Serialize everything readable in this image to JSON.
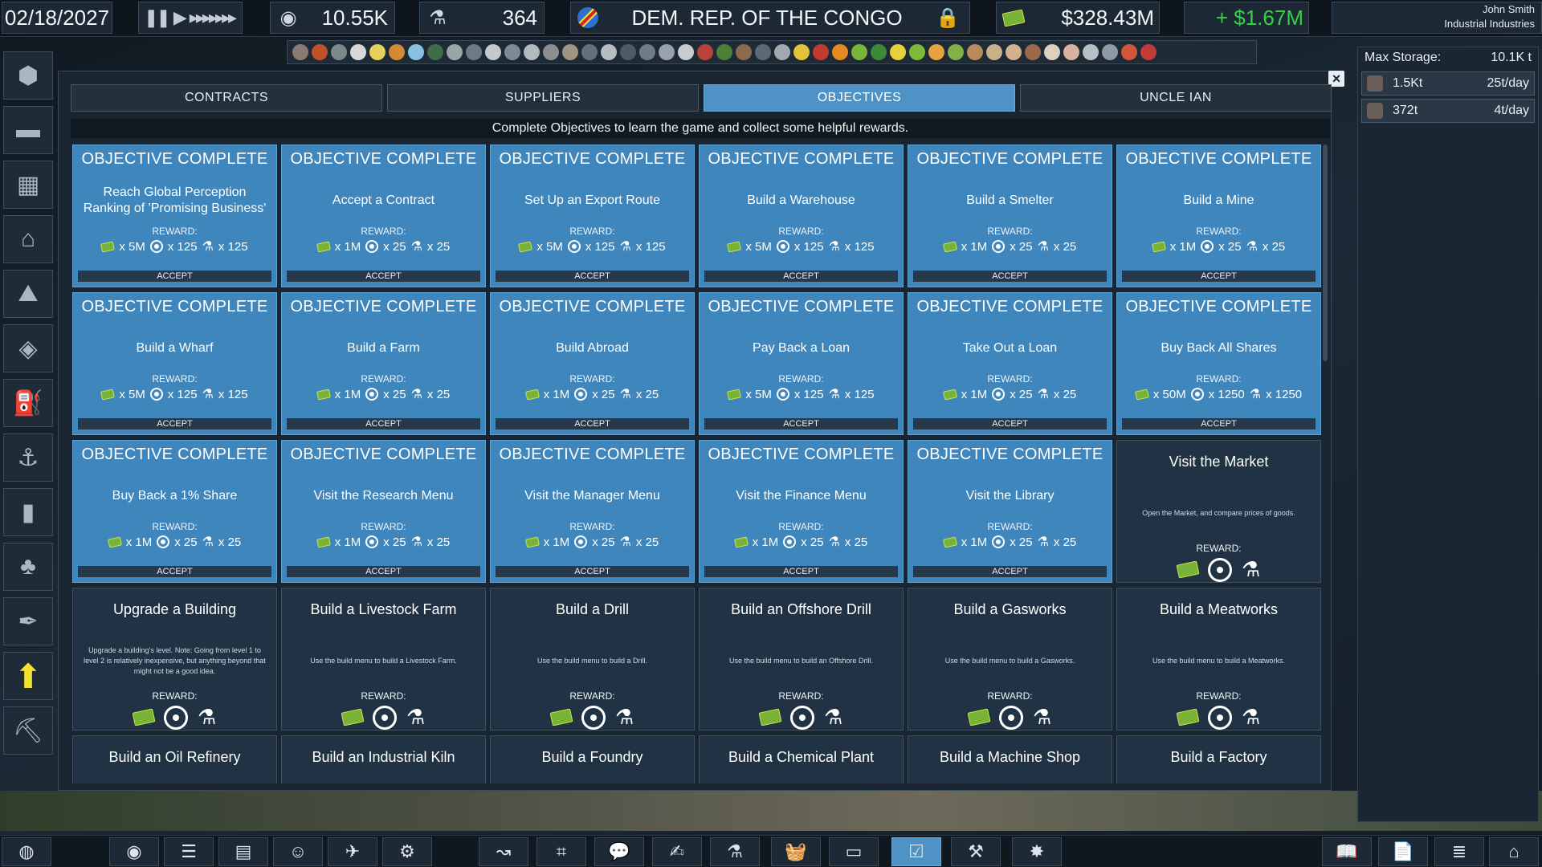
{
  "topbar": {
    "date": "02/18/2027",
    "speed_icons": [
      "pause-icon",
      "play-icon",
      "fast-forward-icon"
    ],
    "perception": "10.55K",
    "research": "364",
    "region": "DEM. REP. OF THE CONGO",
    "cash": "$328.43M",
    "cash_delta": "+ $1.67M",
    "user_name": "John Smith",
    "company": "Industrial Industries"
  },
  "colors": {
    "accent": "#4f92c6",
    "complete_card": "#3f86bd",
    "todo_card": "#203244",
    "cash_delta": "#38d046"
  },
  "tabs": [
    {
      "label": "CONTRACTS",
      "active": false
    },
    {
      "label": "SUPPLIERS",
      "active": false
    },
    {
      "label": "OBJECTIVES",
      "active": true
    },
    {
      "label": "UNCLE IAN",
      "active": false
    }
  ],
  "intro": "Complete Objectives to learn the game and collect some helpful rewards.",
  "status_complete": "OBJECTIVE COMPLETE",
  "reward_label": "REWARD:",
  "accept_label": "ACCEPT",
  "objectives_complete": [
    {
      "title": "Reach Global Perception Ranking of 'Promising Business'",
      "cash": "x 5M",
      "perception": "x 125",
      "research": "x 125"
    },
    {
      "title": "Accept a Contract",
      "cash": "x 1M",
      "perception": "x 25",
      "research": "x 25"
    },
    {
      "title": "Set Up an Export Route",
      "cash": "x 5M",
      "perception": "x 125",
      "research": "x 125"
    },
    {
      "title": "Build a Warehouse",
      "cash": "x 5M",
      "perception": "x 125",
      "research": "x 125"
    },
    {
      "title": "Build a Smelter",
      "cash": "x 1M",
      "perception": "x 25",
      "research": "x 25"
    },
    {
      "title": "Build a Mine",
      "cash": "x 1M",
      "perception": "x 25",
      "research": "x 25"
    },
    {
      "title": "Build a Wharf",
      "cash": "x 5M",
      "perception": "x 125",
      "research": "x 125"
    },
    {
      "title": "Build a Farm",
      "cash": "x 1M",
      "perception": "x 25",
      "research": "x 25"
    },
    {
      "title": "Build Abroad",
      "cash": "x 1M",
      "perception": "x 25",
      "research": "x 25"
    },
    {
      "title": "Pay Back a Loan",
      "cash": "x 5M",
      "perception": "x 125",
      "research": "x 125"
    },
    {
      "title": "Take Out a Loan",
      "cash": "x 1M",
      "perception": "x 25",
      "research": "x 25"
    },
    {
      "title": "Buy Back All Shares",
      "cash": "x 50M",
      "perception": "x 1250",
      "research": "x 1250"
    },
    {
      "title": "Buy Back a 1% Share",
      "cash": "x 1M",
      "perception": "x 25",
      "research": "x 25"
    },
    {
      "title": "Visit the Research Menu",
      "cash": "x 1M",
      "perception": "x 25",
      "research": "x 25"
    },
    {
      "title": "Visit the Manager Menu",
      "cash": "x 1M",
      "perception": "x 25",
      "research": "x 25"
    },
    {
      "title": "Visit the Finance Menu",
      "cash": "x 1M",
      "perception": "x 25",
      "research": "x 25"
    },
    {
      "title": "Visit the Library",
      "cash": "x 1M",
      "perception": "x 25",
      "research": "x 25"
    }
  ],
  "objectives_todo": [
    {
      "title": "Visit the Market",
      "desc": "Open the Market, and compare prices of goods."
    },
    {
      "title": "Upgrade a Building",
      "desc": "Upgrade a building's level. Note: Going from level 1 to level 2 is relatively inexpensive, but anything beyond that might not be a good idea."
    },
    {
      "title": "Build a Livestock Farm",
      "desc": "Use the build menu to build a Livestock Farm."
    },
    {
      "title": "Build a Drill",
      "desc": "Use the build menu to build a Drill."
    },
    {
      "title": "Build an Offshore Drill",
      "desc": "Use the build menu to build an Offshore Drill."
    },
    {
      "title": "Build a Gasworks",
      "desc": "Use the build menu to build a Gasworks."
    },
    {
      "title": "Build a Meatworks",
      "desc": "Use the build menu to build a Meatworks."
    },
    {
      "title": "Build an Oil Refinery",
      "desc": ""
    },
    {
      "title": "Build an Industrial Kiln",
      "desc": ""
    },
    {
      "title": "Build a Foundry",
      "desc": ""
    },
    {
      "title": "Build a Chemical Plant",
      "desc": ""
    },
    {
      "title": "Build a Machine Shop",
      "desc": ""
    },
    {
      "title": "Build a Factory",
      "desc": ""
    }
  ],
  "storage": {
    "label": "Max Storage:",
    "value": "10.1K t",
    "rows": [
      {
        "amount": "1.5Kt",
        "rate": "25t/day"
      },
      {
        "amount": "372t",
        "rate": "4t/day"
      }
    ]
  },
  "left_menu": [
    "resources-icon",
    "warehouse-icon",
    "office-building-icon",
    "factory-icon",
    "mine-icon",
    "storage-icon",
    "drill-icon",
    "wharf-icon",
    "smokestack-icon",
    "farm-icon",
    "eyedropper-icon",
    "upgrade-arrow-icon",
    "bulldozer-icon"
  ],
  "left_menu_glyphs": [
    "⬢",
    "▬",
    "▦",
    "⌂",
    "⛰",
    "◈",
    "⛽",
    "⚓",
    "▮",
    "♣",
    "✒",
    "⬆",
    "⛏"
  ],
  "bottom_menu": [
    "globe-icon",
    "perception-icon",
    "ranking-icon",
    "shares-icon",
    "manager-icon",
    "export-icon",
    "research-icon",
    "route-icon",
    "org-chart-icon",
    "chat-icon",
    "finance-icon",
    "lab-icon",
    "market-icon",
    "cash-icon",
    "objectives-icon",
    "build-icon",
    "achievements-icon",
    "library-icon",
    "news-icon",
    "list-icon",
    "home-icon"
  ],
  "bottom_menu_glyphs": [
    "◍",
    "◉",
    "☰",
    "▤",
    "☺",
    "✈",
    "⚙",
    "↝",
    "⌗",
    "💬",
    "✍",
    "⚗",
    "🧺",
    "▭",
    "☑",
    "⚒",
    "✸",
    "📖",
    "📄",
    "≣",
    "⌂"
  ],
  "goods_colors": [
    "#8a7a72",
    "#c2502a",
    "#7a8a8c",
    "#d8d8d8",
    "#e6d15a",
    "#d48a34",
    "#8ac0e0",
    "#3e6d4a",
    "#9aa5a8",
    "#6f7a82",
    "#c4c9cc",
    "#7c8b95",
    "#b1babf",
    "#8c8f92",
    "#a09582",
    "#62727d",
    "#b5bcc2",
    "#4a5c68",
    "#6e7d88",
    "#99a2a8",
    "#c7ccd0",
    "#b9423a",
    "#4c7f3a",
    "#8b6b4d",
    "#5d6a75",
    "#a3a9ae",
    "#e2c43a",
    "#c33a2e",
    "#e38a24",
    "#78b63a",
    "#3b8a3a",
    "#e8d03a",
    "#7dbb3a",
    "#e6a23c",
    "#82b14a",
    "#b78c5a",
    "#c8b08a",
    "#d4b08c",
    "#9a6a4a",
    "#dcd0c0",
    "#d8b2a0",
    "#b8c0c6",
    "#8f9aa2",
    "#d2563a",
    "#c23a3a"
  ]
}
